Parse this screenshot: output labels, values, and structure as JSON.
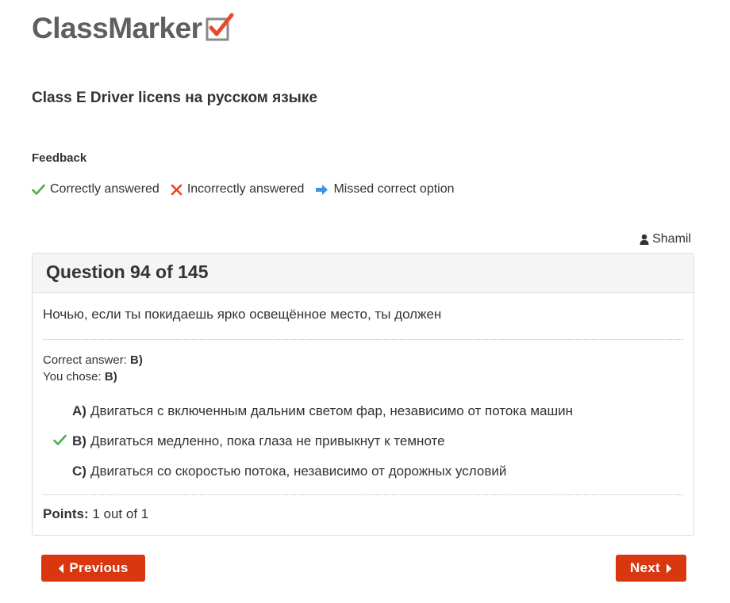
{
  "header": {
    "logo_text": "ClassMarker",
    "logo_icon": "checkbox-check-icon",
    "colors": {
      "logo_text": "#5f5f5f",
      "logo_check": "#e8492a"
    }
  },
  "quiz": {
    "title": "Class E Driver licens на русском языке"
  },
  "feedback": {
    "heading": "Feedback",
    "legend": [
      {
        "icon": "check-icon",
        "label": "Correctly answered",
        "color": "#4cae4c"
      },
      {
        "icon": "cross-icon",
        "label": "Incorrectly answered",
        "color": "#e2432a"
      },
      {
        "icon": "arrow-right-icon",
        "label": "Missed correct option",
        "color": "#3b95e4"
      }
    ]
  },
  "user": {
    "icon": "user-icon",
    "name": "Shamil"
  },
  "question": {
    "header": "Question 94 of 145",
    "text": "Ночью, если ты покидаешь ярко освещённое место, ты должен",
    "correct_answer_label": "Correct answer:",
    "correct_answer_value": "B)",
    "you_chose_label": "You chose:",
    "you_chose_value": "B)",
    "options": [
      {
        "letter": "A)",
        "text": "Двигаться с включенным дальним светом фар, независимо от потока машин",
        "mark": ""
      },
      {
        "letter": "B)",
        "text": "Двигаться медленно, пока глаза не привыкнут к темноте",
        "mark": "check-icon"
      },
      {
        "letter": "C)",
        "text": "Двигаться со скоростью потока, независимо от дорожных условий",
        "mark": ""
      }
    ],
    "points_label": "Points:",
    "points_value": "1 out of 1"
  },
  "navigation": {
    "previous_label": "Previous",
    "next_label": "Next",
    "button_color": "#d9370f"
  }
}
